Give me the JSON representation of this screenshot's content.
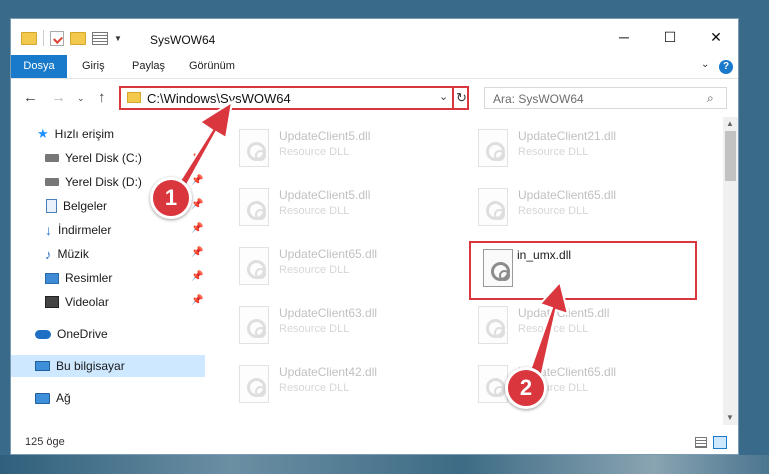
{
  "window": {
    "title": "SysWOW64",
    "controls": {
      "minimize": "─",
      "maximize": "☐",
      "close": "✕"
    }
  },
  "ribbon": {
    "tabs": [
      "Dosya",
      "Giriş",
      "Paylaş",
      "Görünüm"
    ],
    "help": "?",
    "collapse": "⌄"
  },
  "nav": {
    "back": "←",
    "forward": "→",
    "recent": "⌄",
    "up": "↑"
  },
  "address": {
    "path": "C:\\Windows\\SysWOW64",
    "dropdown": "⌄",
    "refresh": "↻"
  },
  "search": {
    "placeholder": "Ara: SysWOW64",
    "icon": "⌕"
  },
  "sidebar": {
    "items": [
      {
        "label": "Hızlı erişim",
        "icon": "star-icon"
      },
      {
        "label": "Yerel Disk (C:)",
        "icon": "disk-icon",
        "pinned": true
      },
      {
        "label": "Yerel Disk (D:)",
        "icon": "disk-icon",
        "pinned": true
      },
      {
        "label": "Belgeler",
        "icon": "documents-icon",
        "pinned": true
      },
      {
        "label": "İndirmeler",
        "icon": "downloads-icon",
        "pinned": true
      },
      {
        "label": "Müzik",
        "icon": "music-icon",
        "pinned": true
      },
      {
        "label": "Resimler",
        "icon": "pictures-icon",
        "pinned": true
      },
      {
        "label": "Videolar",
        "icon": "videos-icon",
        "pinned": true
      },
      {
        "label": "OneDrive",
        "icon": "onedrive-icon"
      },
      {
        "label": "Bu bilgisayar",
        "icon": "this-pc-icon",
        "selected": true
      },
      {
        "label": "Ağ",
        "icon": "network-icon"
      }
    ],
    "pin_glyph": "📌"
  },
  "files": {
    "left": [
      {
        "name": "UpdateClient5.dll",
        "desc": "Resource DLL"
      },
      {
        "name": "UpdateClient5.dll",
        "desc": "Resource DLL"
      },
      {
        "name": "UpdateClient65.dll",
        "desc": "Resource DLL"
      },
      {
        "name": "UpdateClient63.dll",
        "desc": "Resource DLL"
      },
      {
        "name": "UpdateClient42.dll",
        "desc": "Resource DLL"
      }
    ],
    "right": [
      {
        "name": "UpdateClient21.dll",
        "desc": "Resource DLL"
      },
      {
        "name": "UpdateClient65.dll",
        "desc": "Resource DLL"
      },
      {
        "name": "UpdateClient5.dll",
        "desc": "Resource DLL"
      },
      {
        "name": "UpdateClient65.dll",
        "desc": "Resource DLL"
      }
    ],
    "highlighted": {
      "name": "in_umx.dll"
    }
  },
  "status": {
    "count": "125 öge"
  },
  "annotations": {
    "step1": "1",
    "step2": "2",
    "color": "#d9363e"
  }
}
